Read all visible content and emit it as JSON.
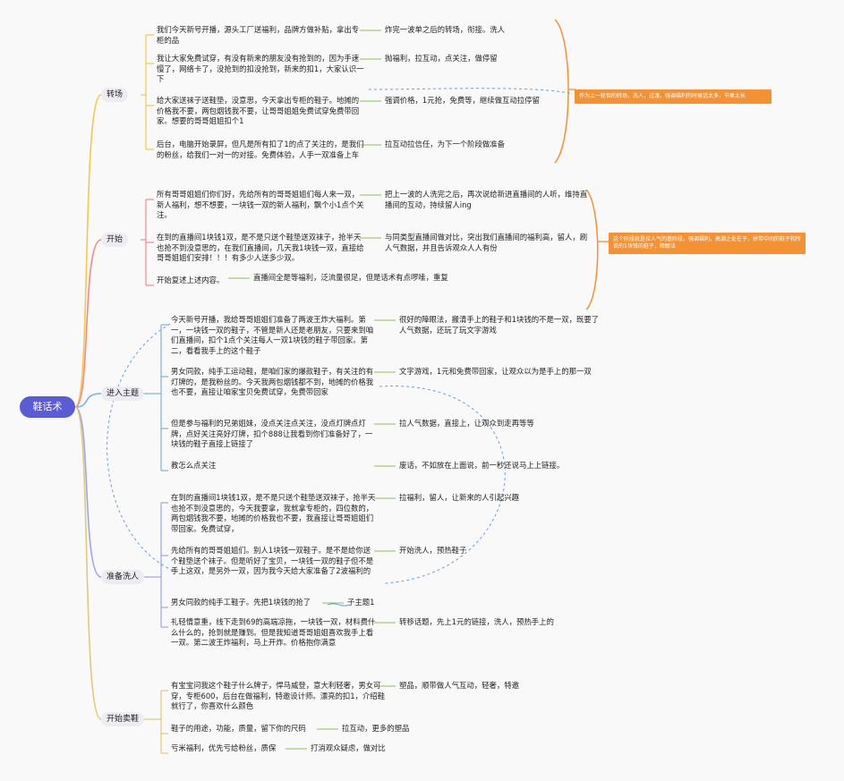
{
  "root": "鞋话术",
  "branches": [
    {
      "label": "转场",
      "color": "#f2c94c",
      "items": [
        {
          "text": "我们今天新号开播，源头工厂送福利，品牌方做补贴，拿出专柜的品",
          "note": "炸完一波单之后的转场，衔接。洗人"
        },
        {
          "text": "我让大家免费试穿，有没有新来的朋友没有抢到的，因为手速慢了，网络卡了，没抢到的扣没抢到，新来的扣1，大家认识一下",
          "note": "抛福利，拉互动，点关注，做停留"
        },
        {
          "text": "给大家送袜子送鞋垫，没意思，今天拿出专柜的鞋子。地摊的价格我不要，两包烟钱我不要，让哥哥姐姐免费试穿免费带回家。想要的哥哥姐姐扣个1",
          "note": "强调价格，1元抢，免费等，继续做互动拉停留"
        },
        {
          "text": "后台，电脑开始录屏，但凡是所有扣了1的点了关注的，是我们的粉丝，给我们一对一的对接。免费体验，人手一双准备上车",
          "note": "拉互动拉信任，为下一个阶段做准备"
        }
      ]
    },
    {
      "label": "开始",
      "color": "#ef8b8b",
      "items": [
        {
          "text": "所有哥哥姐姐们你们好，先给所有的哥哥姐姐们每人来一双，新人福利，想不想要，一块钱一双的新人福利，飘个小1点个关注。",
          "note": "把上一波的人洗完之后，再次说给新进直播间的人听，维持直播间的互动，持续留人ing"
        },
        {
          "text": "在到的直播间1块钱1双，是不是只送个鞋垫送双袜子，抢半天也抢不到没意思的，在我们直播间，几天我1块钱一双，直接给哥哥姐姐们安排！！！有多少人送多少双。",
          "note": "与同类型直播间做对比，突出我们直播间的福利高，留人，刷人气数据，并且告诉观众人人有份"
        },
        {
          "text": "开始复述上述内容。",
          "note": "直播间全是等福利，泛流量很足，但是话术有点啰嗦，重复"
        }
      ]
    },
    {
      "label": "进入主题",
      "color": "#7fb2d9",
      "items": [
        {
          "text": "今天新号开播，我给哥哥姐姐们准备了两波王炸大福利。第一，一块钱一双的鞋子，不管是新人还是老朋友，只要来到咱们直播间，扣个1点个关注每人一双1块钱的鞋子带回家。第二，看看我手上的这个鞋子",
          "note": "很好的障眼法，搬清手上的鞋子和1块钱的不是一双，既要了人气数据，还玩了玩文字游戏"
        },
        {
          "text": "男女同款，纯手工运动鞋，是咱们家的爆款鞋子，有关注的有灯牌的，是我粉丝的。今天我两包烟钱都不到，地摊的价格我也不要，直接让咱家宝贝免费试穿，免费带回家",
          "note": "文字游戏，1元和免费带回家，让观众以为是手上的那一双"
        },
        {
          "text": "但是参与福利的兄弟姐妹，没点关注点关注，没点灯牌点灯牌，点好关注亮好灯牌，扣个888让我看到你们准备好了，一块钱的鞋子直接上链接了",
          "note": "拉人气数据，直接上，让观众到走再等等"
        },
        {
          "text": "教怎么点关注",
          "note": "废话，不如放在上面说，前一秒还说马上上链接。"
        }
      ]
    },
    {
      "label": "准备洗人",
      "color": "#9aa6e8",
      "items": [
        {
          "text": "在到的直播间1块钱1双，是不是只送个鞋垫送双袜子，抢半天也抢不到没意思的，今天我要拿，我就拿专柜的，四位数的，两包烟钱我不要，地摊的价格我也不要，我直接让哥哥姐姐们带回家。免费试穿，",
          "note": "拉福利，留人，让新来的人引起兴趣"
        },
        {
          "text": "先给所有的哥哥姐姐们。别人1块钱一双鞋子。是不是给你送个鞋垫送个袜子。但是听好了宝贝，一块钱一双的鞋子但不是手上这双，是另外一双，因为我今天给大家准备了2波福利的",
          "note": "开始洗人，预热鞋子"
        },
        {
          "text": "男女同款的纯手工鞋子。先把1块钱的抢了",
          "note": "子主题1"
        },
        {
          "text": "礼轻情意重，线下走到69的高端凉拖，一块钱一双，材料费什么什么的，抢到就是赚到。但是我知道哥哥姐姐喜欢我手上看一双。第二波王炸福利，马上开炸。价格抱你满意",
          "note": "转移话题，先上1元的链接，洗人，预热手上的"
        }
      ]
    },
    {
      "label": "开始卖鞋",
      "color": "#e4c87a",
      "items": [
        {
          "text": "有宝宝问我这个鞋子什么牌子，悍马威登，意大利轻奢，男女可穿，专柜600，后台在做福利，特邀设计师。漂亮的扣1，介绍鞋就行了，你喜欢什么颜色",
          "note": "塑品，顺带做人气互动，轻奢，特邀"
        },
        {
          "text": "鞋子的用途，功能，质量，留下你的尺码",
          "note": "拉互动，更多的塑品"
        },
        {
          "text": "亏米福利，优先亏给粉丝，质保",
          "note": "打消观众疑虑，做对比"
        }
      ]
    }
  ],
  "side_notes": [
    {
      "text": "作为上一轮但的转场，洗人，过渡。强调福利的时候话太多，节奏太长"
    },
    {
      "text": "这个阶段就是拉人气的基阶段，强调福利，高潮之处在于，拼带中间的鞋子和所说的1块钱的鞋子，障眼法"
    }
  ],
  "colors": {
    "accent": "#5b5bd6",
    "note": "#f49132",
    "dashed": "#6a9fd8",
    "branch_bg": "#ececf2"
  }
}
